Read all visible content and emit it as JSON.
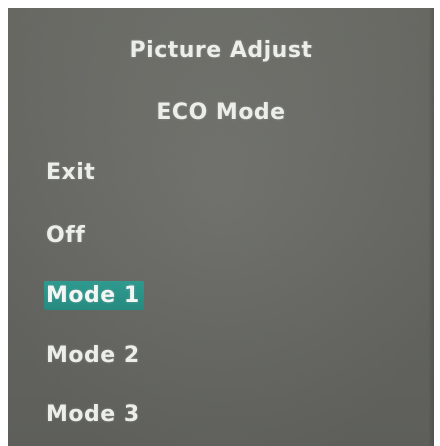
{
  "menu": {
    "title": "Picture Adjust",
    "subtitle": "ECO Mode",
    "options": [
      {
        "label": "Exit",
        "selected": false
      },
      {
        "label": "Off",
        "selected": false
      },
      {
        "label": "Mode 1",
        "selected": true
      },
      {
        "label": "Mode 2",
        "selected": false
      },
      {
        "label": "Mode 3",
        "selected": false
      }
    ],
    "highlight_color": "#2f9a8f",
    "text_color": "#eceeea",
    "background_color": "#6a6b66"
  }
}
